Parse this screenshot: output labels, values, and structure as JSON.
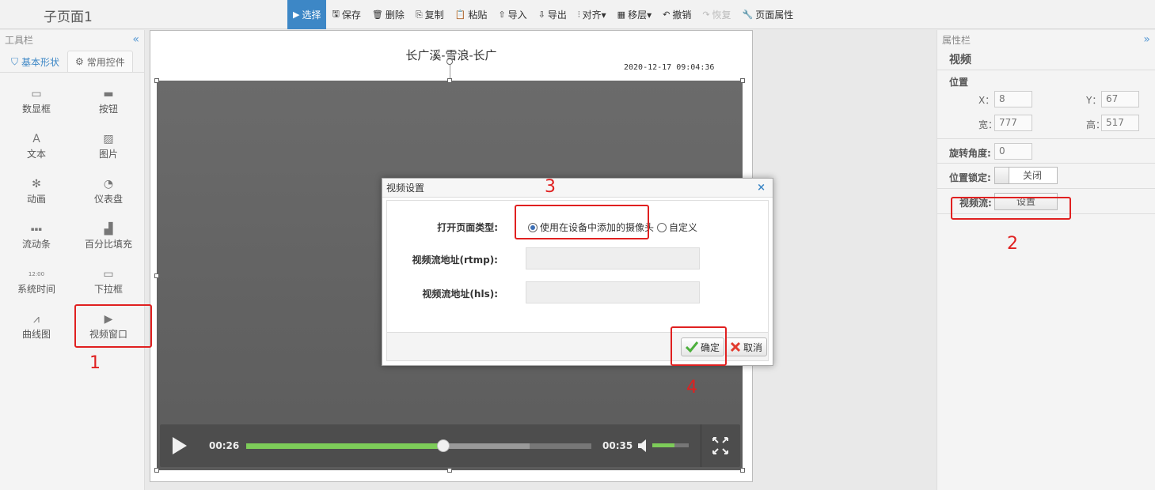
{
  "page_title": "子页面1",
  "toolbar": [
    {
      "icon": "▶",
      "label": "选择",
      "state": "active"
    },
    {
      "icon": "🖫",
      "label": "保存",
      "state": "normal"
    },
    {
      "icon": "🗑",
      "label": "删除",
      "state": "normal"
    },
    {
      "icon": "⎘",
      "label": "复制",
      "state": "normal"
    },
    {
      "icon": "📋",
      "label": "粘贴",
      "state": "normal"
    },
    {
      "icon": "⇧",
      "label": "导入",
      "state": "normal"
    },
    {
      "icon": "⇩",
      "label": "导出",
      "state": "normal"
    },
    {
      "icon": "⫶",
      "label": "对齐▾",
      "state": "normal"
    },
    {
      "icon": "▦",
      "label": "移层▾",
      "state": "normal"
    },
    {
      "icon": "↶",
      "label": "撤销",
      "state": "normal"
    },
    {
      "icon": "↷",
      "label": "恢复",
      "state": "disabled"
    },
    {
      "icon": "🔧",
      "label": "页面属性",
      "state": "normal"
    }
  ],
  "left_panel": {
    "title": "工具栏",
    "collapse_icon": "«",
    "tabs": [
      {
        "icon": "⛉",
        "label": "基本形状"
      },
      {
        "icon": "⚙",
        "label": "常用控件"
      }
    ],
    "controls": [
      {
        "icon": "▭",
        "label": "数显框"
      },
      {
        "icon": "▬",
        "label": "按钮"
      },
      {
        "icon": "A",
        "label": "文本"
      },
      {
        "icon": "▨",
        "label": "图片"
      },
      {
        "icon": "✻",
        "label": "动画"
      },
      {
        "icon": "◔",
        "label": "仪表盘"
      },
      {
        "icon": "▪▪▪",
        "label": "流动条"
      },
      {
        "icon": "▟",
        "label": "百分比填充"
      },
      {
        "icon": "12:00",
        "label": "系统时间"
      },
      {
        "icon": "▭",
        "label": "下拉框"
      },
      {
        "icon": "⩘",
        "label": "曲线图"
      },
      {
        "icon": "▶",
        "label": "视频窗口"
      }
    ]
  },
  "right_panel": {
    "title": "属性栏",
    "expand_icon": "»",
    "object_name": "视频",
    "position_label": "位置",
    "x_label": "X：",
    "x_value": "8",
    "y_label": "Y：",
    "y_value": "67",
    "w_label": "宽：",
    "w_value": "777",
    "h_label": "高：",
    "h_value": "517",
    "rotation_label": "旋转角度:",
    "rotation_value": "0",
    "lock_label": "位置锁定:",
    "lock_value": "关闭",
    "stream_label": "视频流:",
    "stream_button": "设置"
  },
  "canvas": {
    "title": "长广溪-雪浪-长广",
    "timestamp": "2020-12-17 09:04:36",
    "video": {
      "current_time": "00:26",
      "duration": "00:35",
      "progress": 0.57,
      "buffered": 0.82,
      "volume": 0.6
    }
  },
  "dialog": {
    "title": "视频设置",
    "close": "×",
    "type_label": "打开页面类型:",
    "option_camera": "使用在设备中添加的摄像头",
    "option_custom": "自定义",
    "rtmp_label": "视频流地址(rtmp):",
    "rtmp_value": "",
    "hls_label": "视频流地址(hls):",
    "hls_value": "",
    "ok_label": "确定",
    "cancel_label": "取消"
  },
  "annotations": [
    "1",
    "2",
    "3",
    "4"
  ],
  "colors": {
    "accent": "#3d87c6",
    "annotation": "#e02020",
    "progress": "#7dcc59"
  }
}
